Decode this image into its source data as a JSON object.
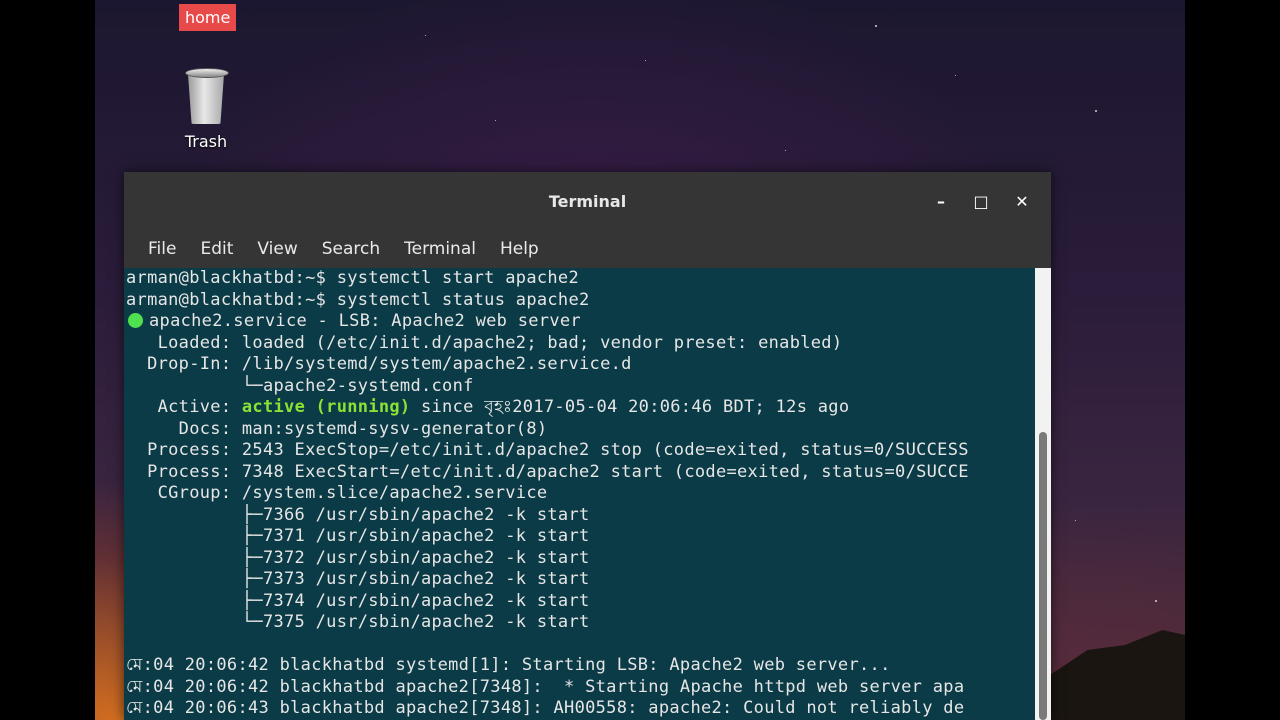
{
  "desktop": {
    "home_label": "home",
    "trash_label": "Trash"
  },
  "window": {
    "title": "Terminal",
    "controls": {
      "minimize": "–",
      "maximize": "□",
      "close": "✕"
    }
  },
  "menu": [
    "File",
    "Edit",
    "View",
    "Search",
    "Terminal",
    "Help"
  ],
  "terminal": {
    "lines": [
      "arman@blackhatbd:~$ systemctl start apache2",
      "arman@blackhatbd:~$ systemctl status apache2",
      "apache2.service - LSB: Apache2 web server",
      "   Loaded: loaded (/etc/init.d/apache2; bad; vendor preset: enabled)",
      "  Drop-In: /lib/systemd/system/apache2.service.d",
      "           └─apache2-systemd.conf",
      "   Active: ",
      "     Docs: man:systemd-sysv-generator(8)",
      "  Process: 2543 ExecStop=/etc/init.d/apache2 stop (code=exited, status=0/SUCCESS",
      "  Process: 7348 ExecStart=/etc/init.d/apache2 start (code=exited, status=0/SUCCE",
      "   CGroup: /system.slice/apache2.service",
      "           ├─7366 /usr/sbin/apache2 -k start",
      "           ├─7371 /usr/sbin/apache2 -k start",
      "           ├─7372 /usr/sbin/apache2 -k start",
      "           ├─7373 /usr/sbin/apache2 -k start",
      "           ├─7374 /usr/sbin/apache2 -k start",
      "           └─7375 /usr/sbin/apache2 -k start",
      "",
      "মে:04 20:06:42 blackhatbd systemd[1]: Starting LSB: Apache2 web server...",
      "মে:04 20:06:42 blackhatbd apache2[7348]:  * Starting Apache httpd web server apa",
      "মে:04 20:06:43 blackhatbd apache2[7348]: AH00558: apache2: Could not reliably de"
    ],
    "active_status": "active (running)",
    "active_rest": " since বৃহঃ2017-05-04 20:06:46 BDT; 12s ago"
  },
  "colors": {
    "terminal_bg": "#0b3b46",
    "active_green": "#8ae234",
    "status_dot": "#4ee04e",
    "home_badge": "#e84a4a"
  }
}
